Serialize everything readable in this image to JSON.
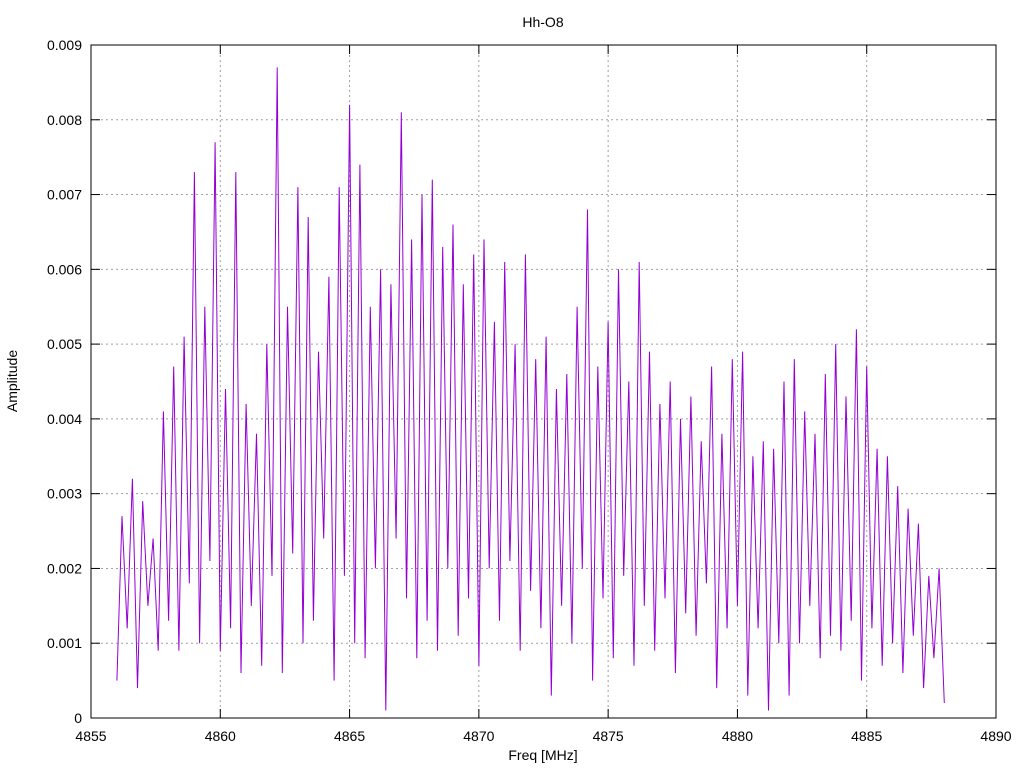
{
  "chart_data": {
    "type": "line",
    "title": "Hh-O8",
    "xlabel": "Freq [MHz]",
    "ylabel": "Amplitude",
    "xlim": [
      4855,
      4890
    ],
    "ylim": [
      0,
      0.009
    ],
    "grid": true,
    "x_ticks": [
      "4855",
      "4860",
      "4865",
      "4870",
      "4875",
      "4880",
      "4885",
      "4890"
    ],
    "y_ticks": [
      "0",
      "0.001",
      "0.002",
      "0.003",
      "0.004",
      "0.005",
      "0.006",
      "0.007",
      "0.008",
      "0.009"
    ],
    "series": [
      {
        "name": "Hh-O8",
        "color": "#9400d3",
        "x_start": 4856,
        "x_step": 0.2,
        "values": [
          0.0005,
          0.0027,
          0.0012,
          0.0032,
          0.0004,
          0.0029,
          0.0015,
          0.0024,
          0.0009,
          0.0041,
          0.0013,
          0.0047,
          0.0009,
          0.0051,
          0.0018,
          0.0073,
          0.001,
          0.0055,
          0.0021,
          0.0077,
          0.0009,
          0.0044,
          0.0012,
          0.0073,
          0.0006,
          0.0042,
          0.0015,
          0.0038,
          0.0007,
          0.005,
          0.0019,
          0.0087,
          0.0006,
          0.0055,
          0.0022,
          0.0071,
          0.001,
          0.0067,
          0.0013,
          0.0049,
          0.0024,
          0.0059,
          0.0005,
          0.0071,
          0.0019,
          0.0082,
          0.001,
          0.0074,
          0.0008,
          0.0055,
          0.002,
          0.006,
          0.0001,
          0.0058,
          0.0024,
          0.0081,
          0.0016,
          0.0064,
          0.0008,
          0.007,
          0.0013,
          0.0072,
          0.0009,
          0.0063,
          0.002,
          0.0066,
          0.0011,
          0.0058,
          0.0016,
          0.0062,
          0.0007,
          0.0064,
          0.002,
          0.0053,
          0.0013,
          0.0061,
          0.0021,
          0.005,
          0.0009,
          0.0062,
          0.0017,
          0.0048,
          0.0012,
          0.0051,
          0.0003,
          0.0044,
          0.0015,
          0.0046,
          0.001,
          0.0055,
          0.002,
          0.0068,
          0.0005,
          0.0047,
          0.0016,
          0.0053,
          0.0008,
          0.006,
          0.0019,
          0.0045,
          0.0007,
          0.0061,
          0.0015,
          0.0049,
          0.0009,
          0.0042,
          0.0016,
          0.0045,
          0.0006,
          0.004,
          0.0014,
          0.0043,
          0.0011,
          0.0037,
          0.0018,
          0.0047,
          0.0004,
          0.0038,
          0.0012,
          0.0048,
          0.0015,
          0.0049,
          0.0003,
          0.0035,
          0.0012,
          0.0037,
          0.0001,
          0.0036,
          0.001,
          0.0045,
          0.0003,
          0.0048,
          0.001,
          0.0041,
          0.0015,
          0.0038,
          0.0008,
          0.0046,
          0.0011,
          0.005,
          0.0009,
          0.0043,
          0.0013,
          0.0052,
          0.0005,
          0.0047,
          0.0012,
          0.0036,
          0.0007,
          0.0035,
          0.001,
          0.0031,
          0.0006,
          0.0028,
          0.0011,
          0.0026,
          0.0004,
          0.0019,
          0.0008,
          0.002,
          0.0002
        ]
      }
    ]
  }
}
